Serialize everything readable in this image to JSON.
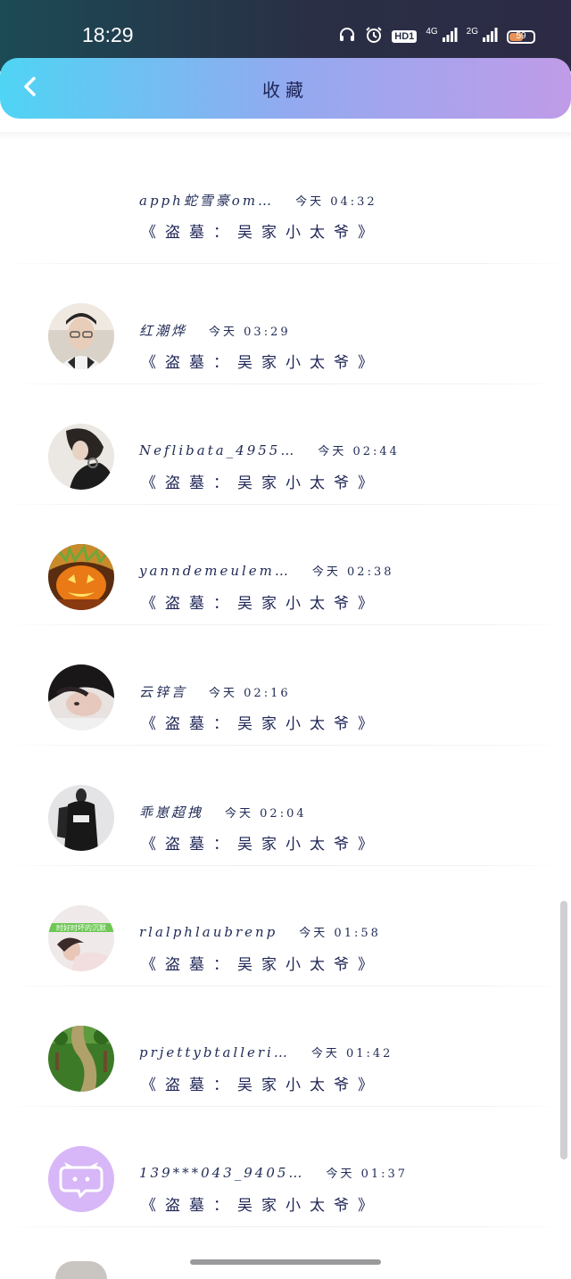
{
  "status_bar": {
    "time": "18:29",
    "hd_label": "HD1",
    "network_4g": "4G",
    "network_2g": "2G",
    "battery_percent": "59",
    "battery_level": 0.59
  },
  "header": {
    "title": "收藏"
  },
  "colors": {
    "header_gradient_start": "#4fd4f4",
    "header_gradient_end": "#c09be8",
    "text_dark": "#1e2455",
    "battery": "#e8925a"
  },
  "items": [
    {
      "name": "apph蛇雪豪om…",
      "time": "今天 04:32",
      "title": "《盗墓：吴家小太爷》",
      "avatar": "none"
    },
    {
      "name": "红潮烨",
      "time": "今天 03:29",
      "title": "《盗墓：吴家小太爷》",
      "avatar": "man-glasses-avatar"
    },
    {
      "name": "Neflibata_4955…",
      "time": "今天 02:44",
      "title": "《盗墓：吴家小太爷》",
      "avatar": "girl-headphones-avatar"
    },
    {
      "name": "yanndemeulem…",
      "time": "今天 02:38",
      "title": "《盗墓：吴家小太爷》",
      "avatar": "pumpkin-avatar"
    },
    {
      "name": "云锌言",
      "time": "今天 02:16",
      "title": "《盗墓：吴家小太爷》",
      "avatar": "dark-hair-avatar"
    },
    {
      "name": "乖崽超拽",
      "time": "今天 02:04",
      "title": "《盗墓：吴家小太爷》",
      "avatar": "dark-outfit-avatar"
    },
    {
      "name": "rlalphlaubrenp",
      "time": "今天 01:58",
      "title": "《盗墓：吴家小太爷》",
      "avatar": "green-banner-avatar",
      "avatar_text": "时好时坏的沉默"
    },
    {
      "name": "prjettybtalleri…",
      "time": "今天 01:42",
      "title": "《盗墓：吴家小太爷》",
      "avatar": "garden-path-avatar"
    },
    {
      "name": "139***043_9405…",
      "time": "今天 01:37",
      "title": "《盗墓：吴家小太爷》",
      "avatar": "chat-bubble-avatar"
    }
  ]
}
